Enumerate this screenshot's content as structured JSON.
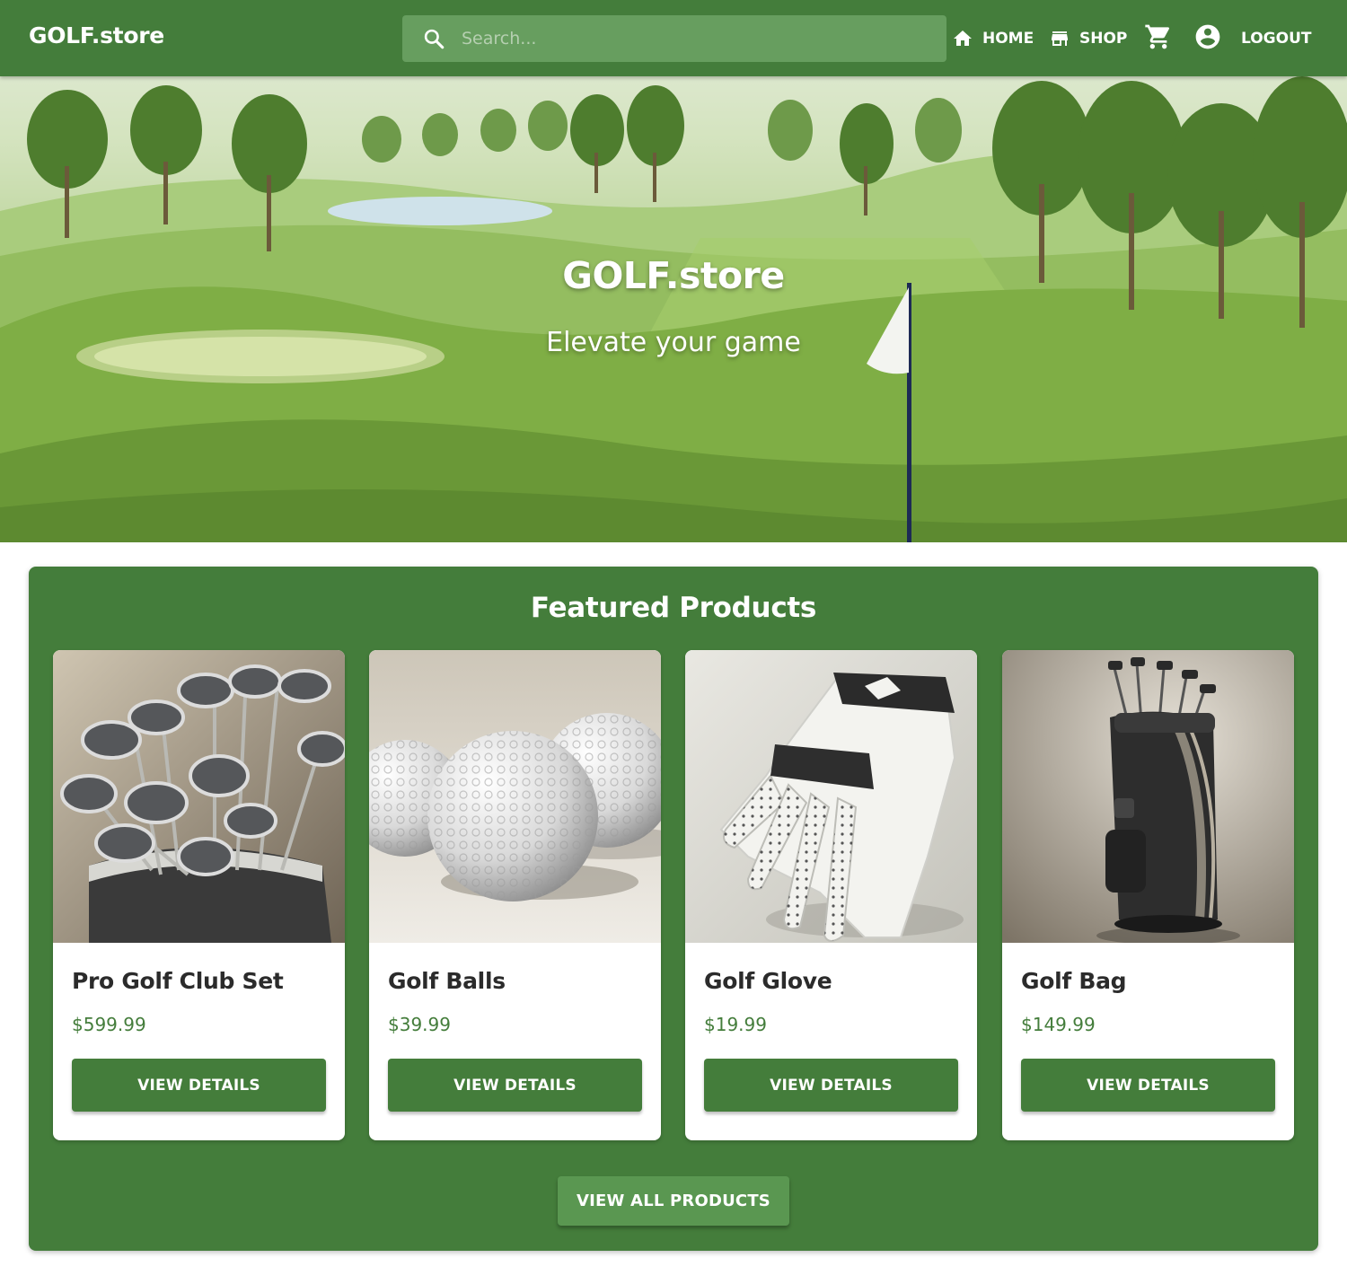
{
  "header": {
    "logo": "GOLF.store",
    "search": {
      "placeholder": "Search...",
      "value": ""
    },
    "nav": {
      "home_label": "HOME",
      "shop_label": "SHOP",
      "logout_label": "LOGOUT"
    }
  },
  "hero": {
    "title": "GOLF.store",
    "subtitle": "Elevate your game"
  },
  "featured": {
    "title": "Featured Products",
    "products": [
      {
        "name": "Pro Golf Club Set",
        "price": "$599.99",
        "button_label": "VIEW DETAILS",
        "image": "golf-clubs-image"
      },
      {
        "name": "Golf Balls",
        "price": "$39.99",
        "button_label": "VIEW DETAILS",
        "image": "golf-balls-image"
      },
      {
        "name": "Golf Glove",
        "price": "$19.99",
        "button_label": "VIEW DETAILS",
        "image": "golf-glove-image"
      },
      {
        "name": "Golf Bag",
        "price": "$149.99",
        "button_label": "VIEW DETAILS",
        "image": "golf-bag-image"
      }
    ],
    "view_all_label": "VIEW ALL PRODUCTS"
  },
  "colors": {
    "brand_green": "#447d3b",
    "search_bg": "#679e5f",
    "view_all_bg": "#5a9751",
    "card_bg": "#ffffff"
  },
  "icons": [
    "search-icon",
    "home-icon",
    "store-icon",
    "cart-icon",
    "account-circle-icon"
  ]
}
